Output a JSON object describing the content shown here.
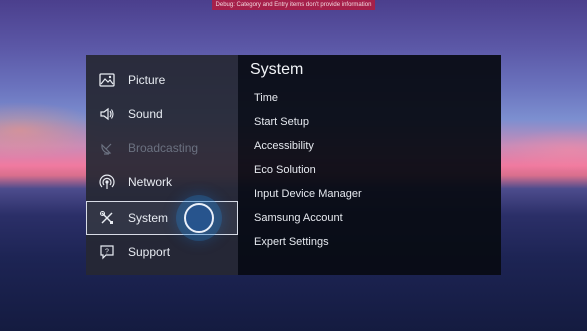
{
  "notice": "Debug: Category and Entry items don't provide information",
  "sidebar": {
    "items": [
      {
        "label": "Picture",
        "icon": "picture-icon",
        "disabled": false,
        "selected": false
      },
      {
        "label": "Sound",
        "icon": "speaker-icon",
        "disabled": false,
        "selected": false
      },
      {
        "label": "Broadcasting",
        "icon": "satellite-dish-icon",
        "disabled": true,
        "selected": false
      },
      {
        "label": "Network",
        "icon": "network-icon",
        "disabled": false,
        "selected": false
      },
      {
        "label": "System",
        "icon": "tools-icon",
        "disabled": false,
        "selected": true
      },
      {
        "label": "Support",
        "icon": "support-icon",
        "disabled": false,
        "selected": false
      }
    ]
  },
  "panel": {
    "title": "System",
    "options": [
      "Time",
      "Start Setup",
      "Accessibility",
      "Eco Solution",
      "Input Device Manager",
      "Samsung Account",
      "Expert Settings"
    ]
  },
  "colors": {
    "selection_outline": "#d8dce6",
    "focus_cursor": "#1e6ec8",
    "notice_bar": "#a5204a"
  }
}
